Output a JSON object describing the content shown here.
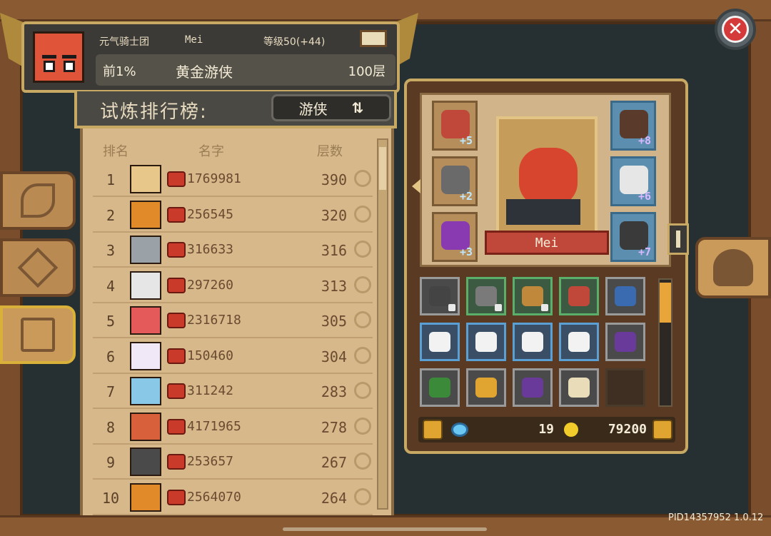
{
  "close_label": "✕",
  "player": {
    "guild": "元气骑士团",
    "name": "Mei",
    "level": "等级50(+44)",
    "rank_percent": "前1%",
    "title": "黄金游侠",
    "floor": "100层"
  },
  "leaderboard": {
    "title": "试炼排行榜:",
    "class_selector": "游侠",
    "swap_icon": "⇅",
    "headers": {
      "rank": "排名",
      "name": "名字",
      "floor": "层数"
    },
    "rows": [
      {
        "rank": "1",
        "uid": "1769981",
        "floor": "390",
        "face_color": "#e8c88a"
      },
      {
        "rank": "2",
        "uid": "256545",
        "floor": "320",
        "face_color": "#e08a2a"
      },
      {
        "rank": "3",
        "uid": "316633",
        "floor": "316",
        "face_color": "#9aa2a8"
      },
      {
        "rank": "4",
        "uid": "297260",
        "floor": "313",
        "face_color": "#e6e6e6"
      },
      {
        "rank": "5",
        "uid": "2316718",
        "floor": "305",
        "face_color": "#e45a5a"
      },
      {
        "rank": "6",
        "uid": "150460",
        "floor": "304",
        "face_color": "#f0e8f6"
      },
      {
        "rank": "7",
        "uid": "311242",
        "floor": "283",
        "face_color": "#8ac8e8"
      },
      {
        "rank": "8",
        "uid": "4171965",
        "floor": "278",
        "face_color": "#d8603a"
      },
      {
        "rank": "9",
        "uid": "253657",
        "floor": "267",
        "face_color": "#4a4a4a"
      },
      {
        "rank": "10",
        "uid": "2564070",
        "floor": "264",
        "face_color": "#e08a2a"
      }
    ]
  },
  "equipment": {
    "hero_name": "Mei",
    "left_slots": [
      {
        "level": "+5",
        "color": "#c0483a"
      },
      {
        "level": "+2",
        "color": "#6a6a6a"
      },
      {
        "level": "+3",
        "color": "#8a3ab0"
      }
    ],
    "right_slots": [
      {
        "level": "+8",
        "color": "#5a3a2a"
      },
      {
        "level": "+6",
        "color": "#e6e6e6"
      },
      {
        "level": "+7",
        "color": "#3a3a3a"
      }
    ]
  },
  "inventory": [
    {
      "tier": "t-gray",
      "color": "#444444",
      "locked": true
    },
    {
      "tier": "t-green",
      "color": "#7a7a7a",
      "locked": true
    },
    {
      "tier": "t-green",
      "color": "#c0883a",
      "locked": true
    },
    {
      "tier": "t-green",
      "color": "#c0483a",
      "locked": false
    },
    {
      "tier": "t-gray",
      "color": "#3a6ab0",
      "locked": false
    },
    {
      "tier": "t-blue",
      "color": "#f2f2f2",
      "locked": false
    },
    {
      "tier": "t-blue",
      "color": "#f2f2f2",
      "locked": false
    },
    {
      "tier": "t-blue",
      "color": "#f2f2f2",
      "locked": false
    },
    {
      "tier": "t-blue",
      "color": "#f2f2f2",
      "locked": false
    },
    {
      "tier": "t-gray",
      "color": "#6a3a9a",
      "locked": false
    },
    {
      "tier": "t-gray",
      "color": "#3a8a3a",
      "locked": false
    },
    {
      "tier": "t-gray",
      "color": "#e0a530",
      "locked": false
    },
    {
      "tier": "t-gray",
      "color": "#6a3a9a",
      "locked": false
    },
    {
      "tier": "t-gray",
      "color": "#e9dcb8",
      "locked": false
    },
    {
      "tier": "t-empty",
      "color": "",
      "locked": false
    }
  ],
  "currency": {
    "gems": "19",
    "coins": "79200"
  },
  "version": "PID14357952 1.0.12"
}
